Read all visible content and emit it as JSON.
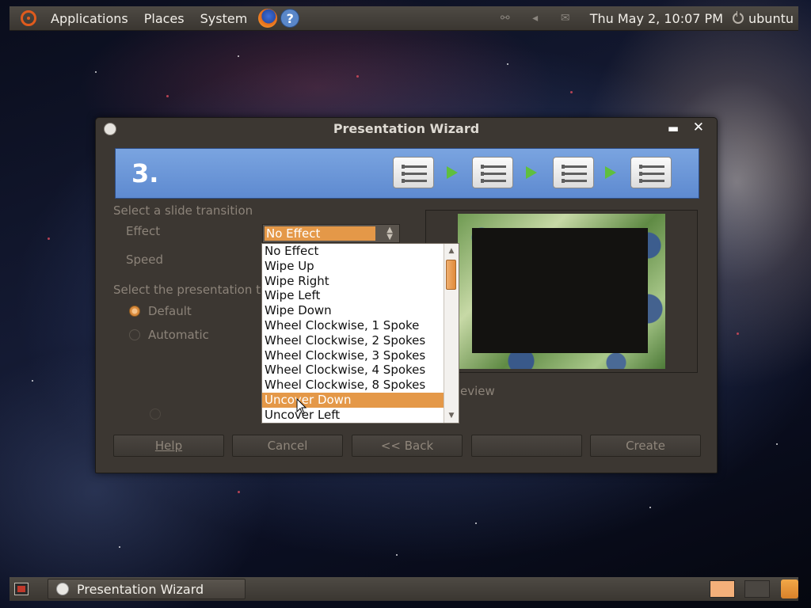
{
  "top_panel": {
    "menus": [
      "Applications",
      "Places",
      "System"
    ],
    "clock": "Thu May  2, 10:07 PM",
    "user": "ubuntu"
  },
  "bottom_panel": {
    "task": "Presentation Wizard"
  },
  "dialog": {
    "title": "Presentation Wizard",
    "step": "3.",
    "transition_heading": "Select a slide transition",
    "effect_label": "Effect",
    "speed_label": "Speed",
    "presentation_heading": "Select the presentation t",
    "radio_default": "Default",
    "radio_automatic": "Automatic",
    "preview_label": "eview",
    "effect_value": "No Effect",
    "effect_options": [
      "No Effect",
      "Wipe Up",
      "Wipe Right",
      "Wipe Left",
      "Wipe Down",
      "Wheel Clockwise, 1 Spoke",
      "Wheel Clockwise, 2 Spokes",
      "Wheel Clockwise, 3 Spokes",
      "Wheel Clockwise, 4 Spokes",
      "Wheel Clockwise, 8 Spokes",
      "Uncover Down",
      "Uncover Left"
    ],
    "selected_option": "Uncover Down",
    "buttons": {
      "help": "Help",
      "cancel": "Cancel",
      "back": "<< Back",
      "next": "",
      "create": "Create"
    }
  },
  "colors": {
    "accent": "#e49848",
    "banner": "#6a94d6"
  }
}
